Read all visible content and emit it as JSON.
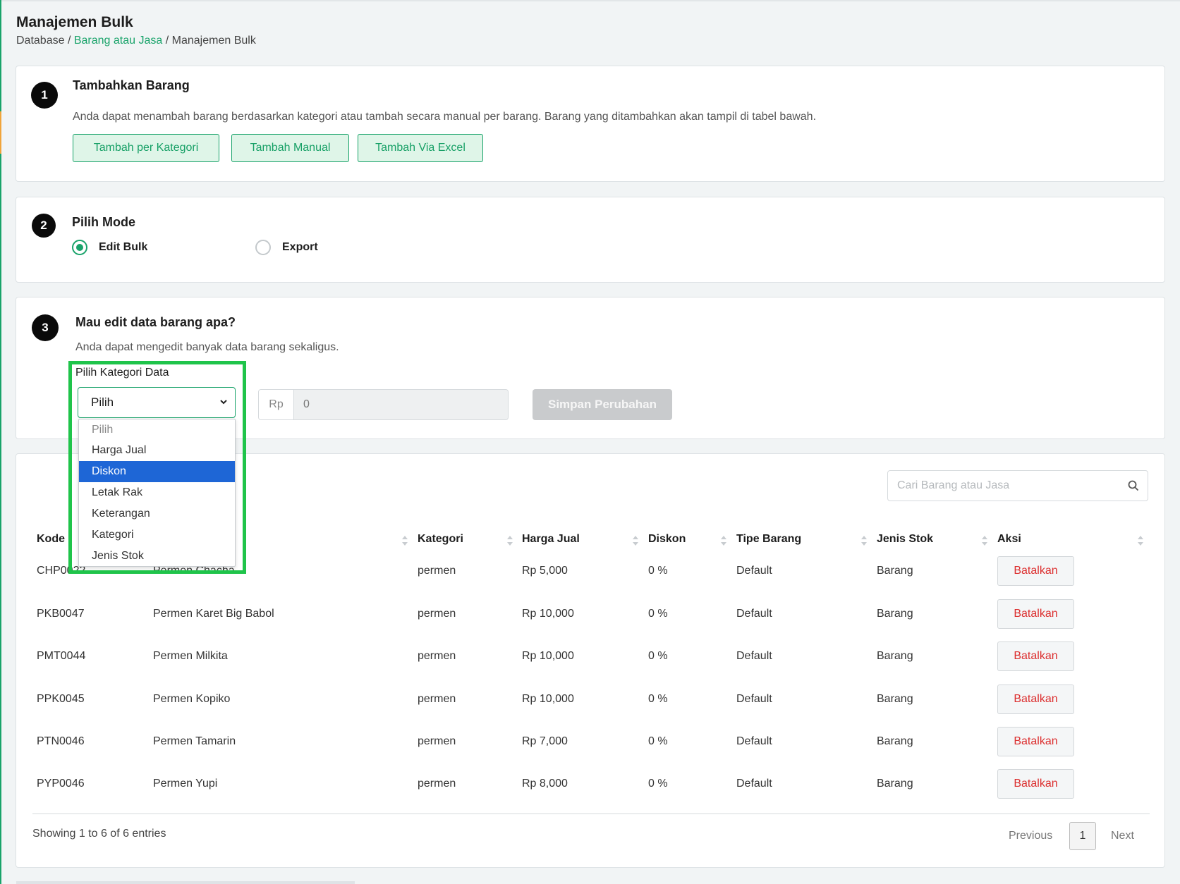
{
  "page": {
    "title": "Manajemen Bulk",
    "breadcrumb": {
      "root": "Database",
      "sep": "/",
      "link": "Barang atau Jasa",
      "current": "Manajemen Bulk"
    }
  },
  "step1": {
    "number": "1",
    "title": "Tambahkan Barang",
    "desc": "Anda dapat menambah barang berdasarkan kategori atau tambah secara manual per barang. Barang yang ditambahkan akan tampil di tabel bawah.",
    "buttons": [
      "Tambah per Kategori",
      "Tambah Manual",
      "Tambah Via Excel"
    ]
  },
  "step2": {
    "number": "2",
    "title": "Pilih Mode",
    "options": [
      {
        "label": "Edit Bulk",
        "checked": true
      },
      {
        "label": "Export",
        "checked": false
      }
    ]
  },
  "step3": {
    "number": "3",
    "title": "Mau edit data barang apa?",
    "desc": "Anda dapat mengedit banyak data barang sekaligus.",
    "field_label": "Pilih Kategori Data",
    "select_value": "Pilih",
    "dropdown_options": [
      "Pilih",
      "Harga Jual",
      "Diskon",
      "Letak Rak",
      "Keterangan",
      "Kategori",
      "Jenis Stok"
    ],
    "dropdown_highlighted": "Diskon",
    "currency_prefix": "Rp",
    "amount_placeholder": "0",
    "save_label": "Simpan Perubahan"
  },
  "table": {
    "search_placeholder": "Cari Barang atau Jasa",
    "headers": [
      "Kode",
      "Kategori",
      "Harga Jual",
      "Diskon",
      "Tipe Barang",
      "Jenis Stok",
      "Aksi"
    ],
    "rows": [
      {
        "kode": "CHP0022",
        "nama": "Permen Chacha",
        "kategori": "permen",
        "harga": "Rp 5,000",
        "diskon": "0 %",
        "tipe": "Default",
        "jenis": "Barang",
        "aksi": "Batalkan"
      },
      {
        "kode": "PKB0047",
        "nama": "Permen Karet Big Babol",
        "kategori": "permen",
        "harga": "Rp 10,000",
        "diskon": "0 %",
        "tipe": "Default",
        "jenis": "Barang",
        "aksi": "Batalkan"
      },
      {
        "kode": "PMT0044",
        "nama": "Permen Milkita",
        "kategori": "permen",
        "harga": "Rp 10,000",
        "diskon": "0 %",
        "tipe": "Default",
        "jenis": "Barang",
        "aksi": "Batalkan"
      },
      {
        "kode": "PPK0045",
        "nama": "Permen Kopiko",
        "kategori": "permen",
        "harga": "Rp 10,000",
        "diskon": "0 %",
        "tipe": "Default",
        "jenis": "Barang",
        "aksi": "Batalkan"
      },
      {
        "kode": "PTN0046",
        "nama": "Permen Tamarin",
        "kategori": "permen",
        "harga": "Rp 7,000",
        "diskon": "0 %",
        "tipe": "Default",
        "jenis": "Barang",
        "aksi": "Batalkan"
      },
      {
        "kode": "PYP0046",
        "nama": "Permen Yupi",
        "kategori": "permen",
        "harga": "Rp 8,000",
        "diskon": "0 %",
        "tipe": "Default",
        "jenis": "Barang",
        "aksi": "Batalkan"
      }
    ],
    "info": "Showing 1 to 6 of 6 entries",
    "prev_label": "Previous",
    "current_page": "1",
    "next_label": "Next"
  },
  "colors": {
    "accent": "#19a36a",
    "danger": "#dc2f2f",
    "highlight": "#1fc44a",
    "option_selected": "#1e66d6"
  },
  "icons": {
    "search": "search-icon",
    "sort": "sort-icon",
    "chevron": "chevron-down-icon"
  }
}
